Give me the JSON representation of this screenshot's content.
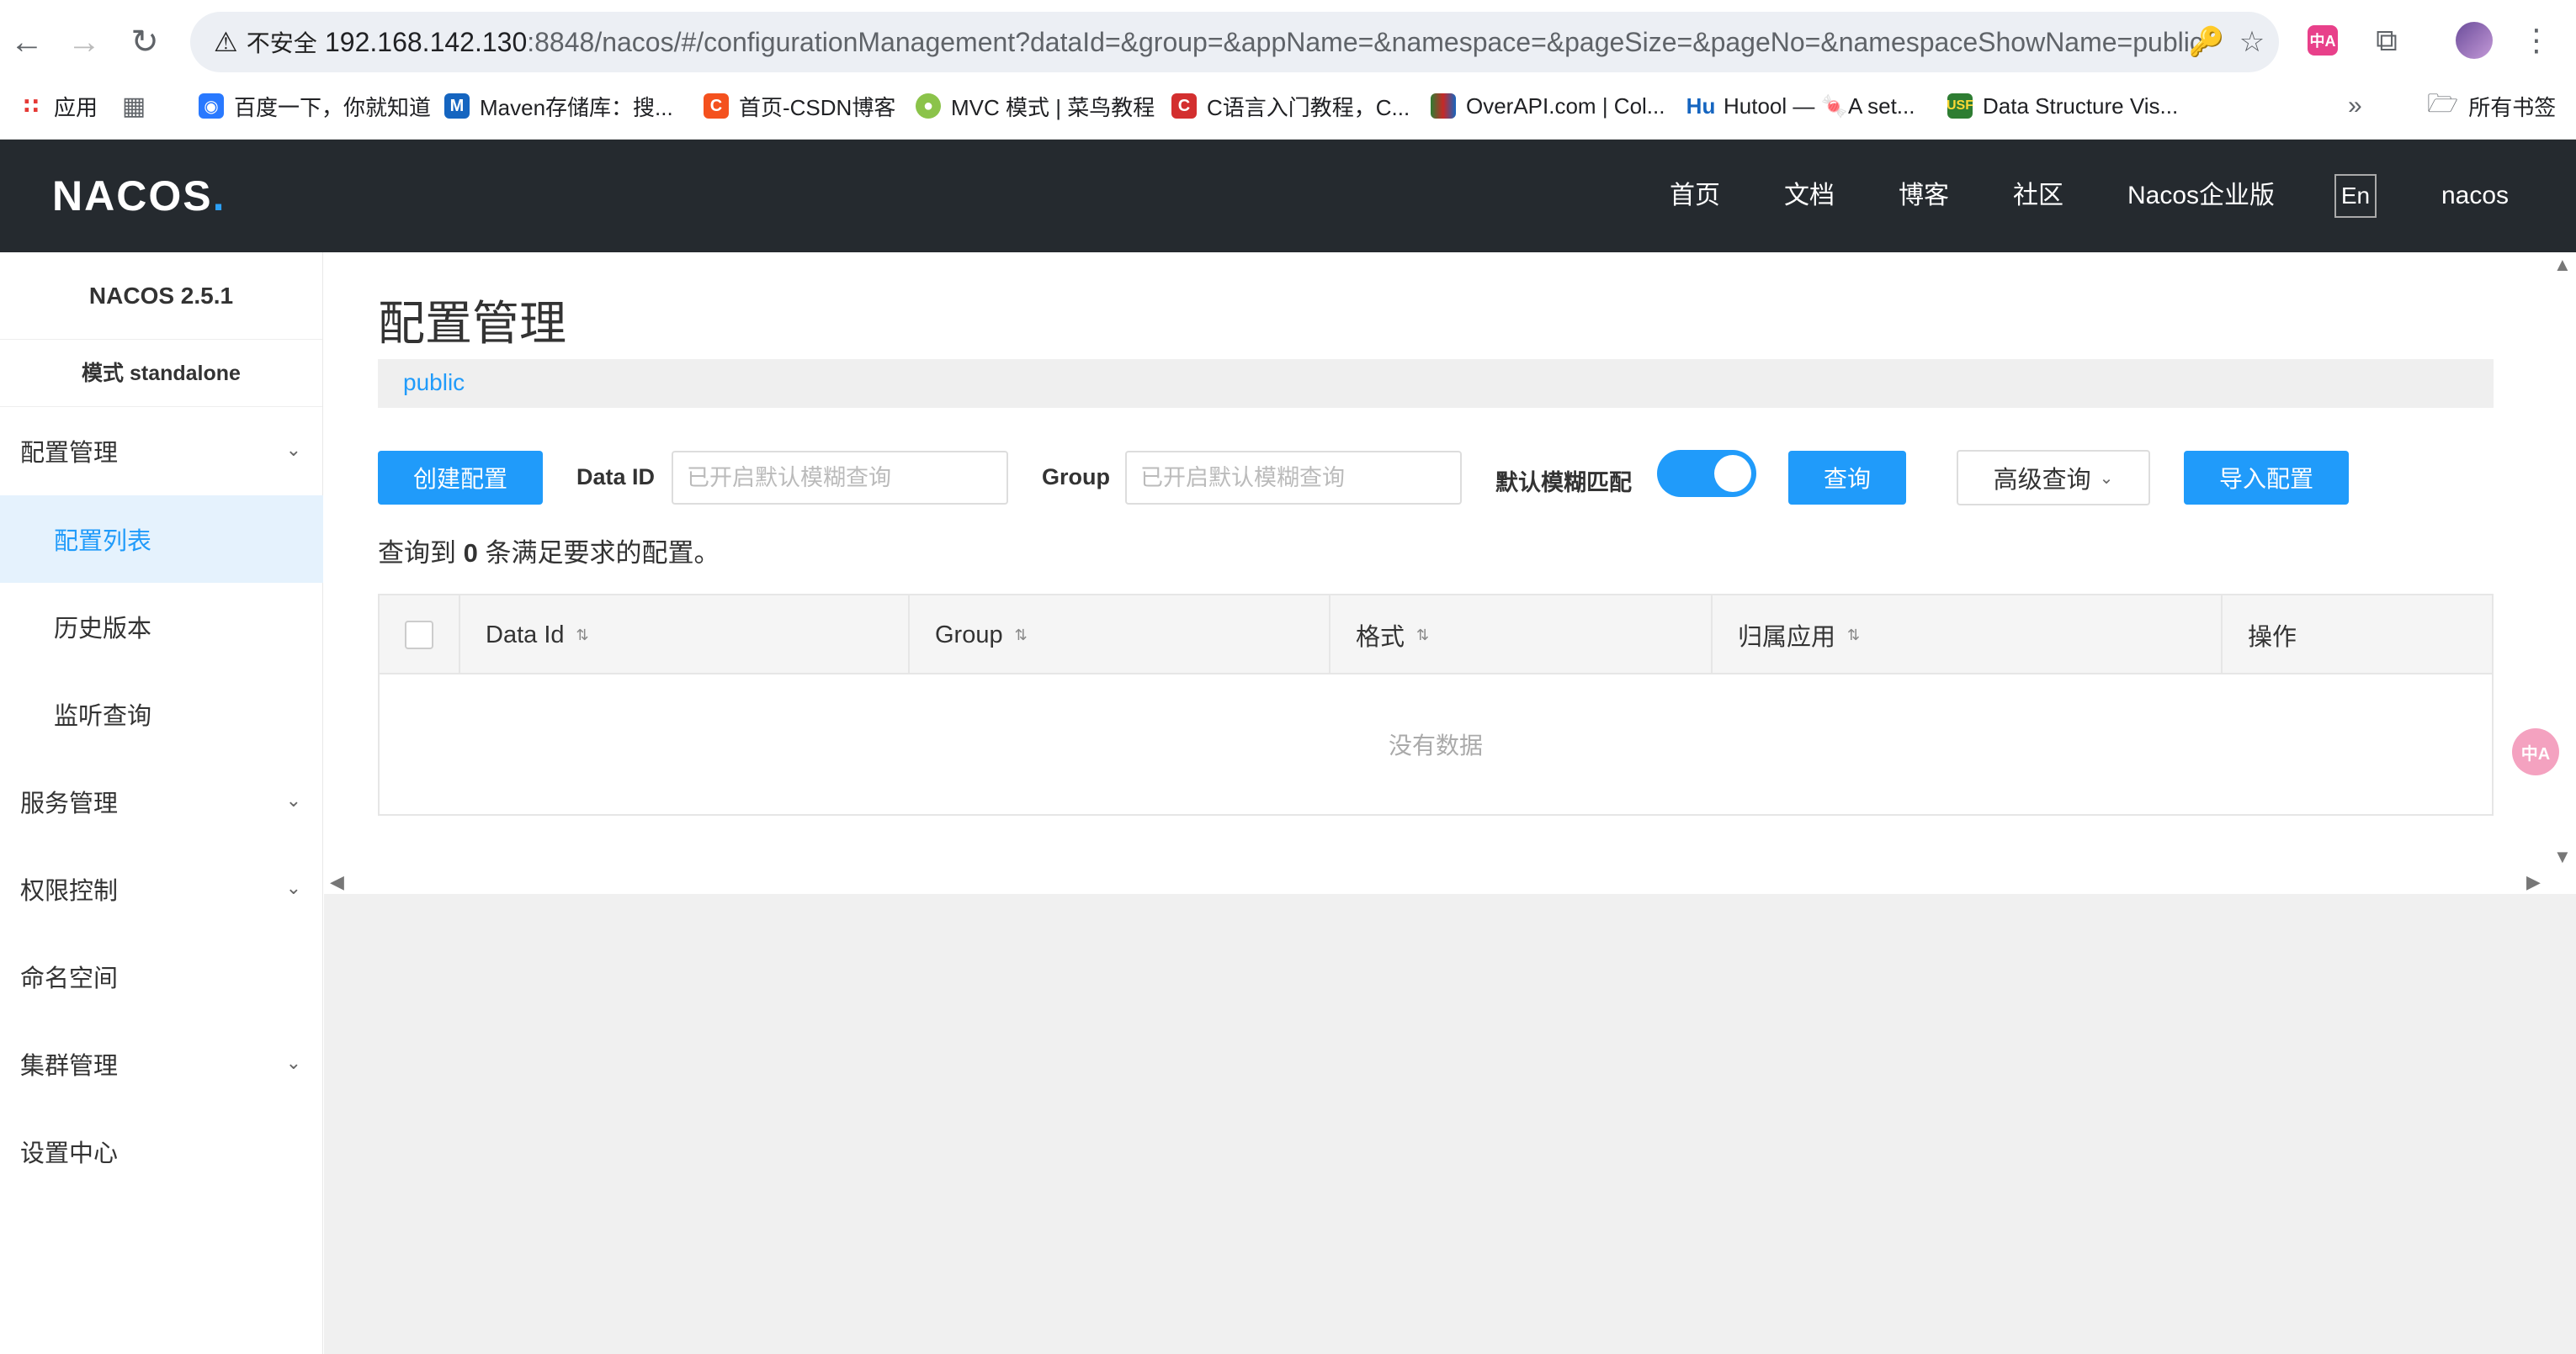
{
  "browser": {
    "security_label": "不安全",
    "url_host": "192.168.142.130",
    "url_rest": ":8848/nacos/#/configurationManagement?dataId=&group=&appName=&namespace=&pageSize=&pageNo=&namespaceShowName=public",
    "translate_badge": "中A",
    "bookmarks": [
      {
        "label": "应用",
        "icon": "apps-grid-icon",
        "color": "#e53935"
      },
      {
        "label": "",
        "icon": "tab-groups-icon",
        "color": "#5f6368"
      },
      {
        "label": "百度一下，你就知道",
        "icon": "baidu-icon",
        "color": "#2979ff"
      },
      {
        "label": "Maven存储库：搜...",
        "icon": "maven-icon",
        "color": "#1565c0"
      },
      {
        "label": "首页-CSDN博客",
        "icon": "csdn-icon",
        "color": "#f4511e"
      },
      {
        "label": "MVC 模式 | 菜鸟教程",
        "icon": "runoob-icon",
        "color": "#8bc34a"
      },
      {
        "label": "C语言入门教程，C...",
        "icon": "c-icon",
        "color": "#d32f2f"
      },
      {
        "label": "OverAPI.com | Col...",
        "icon": "overapi-icon",
        "color": "#2e7d32"
      },
      {
        "label": "Hutool — 🍬A set...",
        "icon": "hutool-icon",
        "color": "#1565c0"
      },
      {
        "label": "Data Structure Vis...",
        "icon": "usf-icon",
        "color": "#2e7d32"
      }
    ],
    "all_bookmarks": "所有书签"
  },
  "header": {
    "logo_main": "NACOS",
    "logo_dot": ".",
    "nav": [
      "首页",
      "文档",
      "博客",
      "社区",
      "Nacos企业版"
    ],
    "lang": "En",
    "user": "nacos"
  },
  "sidebar": {
    "version": "NACOS 2.5.1",
    "mode": "模式 standalone",
    "items": [
      {
        "label": "配置管理",
        "expandable": true
      },
      {
        "label": "配置列表",
        "sub": true,
        "active": true
      },
      {
        "label": "历史版本",
        "sub": true
      },
      {
        "label": "监听查询",
        "sub": true
      },
      {
        "label": "服务管理",
        "expandable": true
      },
      {
        "label": "权限控制",
        "expandable": true
      },
      {
        "label": "命名空间"
      },
      {
        "label": "集群管理",
        "expandable": true
      },
      {
        "label": "设置中心"
      }
    ]
  },
  "main": {
    "title": "配置管理",
    "namespace": "public",
    "create_button": "创建配置",
    "dataid_label": "Data ID",
    "dataid_placeholder": "已开启默认模糊查询",
    "group_label": "Group",
    "group_placeholder": "已开启默认模糊查询",
    "fuzzy_label": "默认模糊匹配",
    "fuzzy_enabled": true,
    "query_button": "查询",
    "advanced_button": "高级查询",
    "import_button": "导入配置",
    "result_prefix": "查询到",
    "result_count": "0",
    "result_suffix": "条满足要求的配置。",
    "table": {
      "columns": [
        "Data Id",
        "Group",
        "格式",
        "归属应用",
        "操作"
      ],
      "empty_text": "没有数据"
    }
  },
  "colors": {
    "primary": "#209bfa",
    "header_bg": "#252a2f",
    "active_bg": "#e5f2fd"
  }
}
